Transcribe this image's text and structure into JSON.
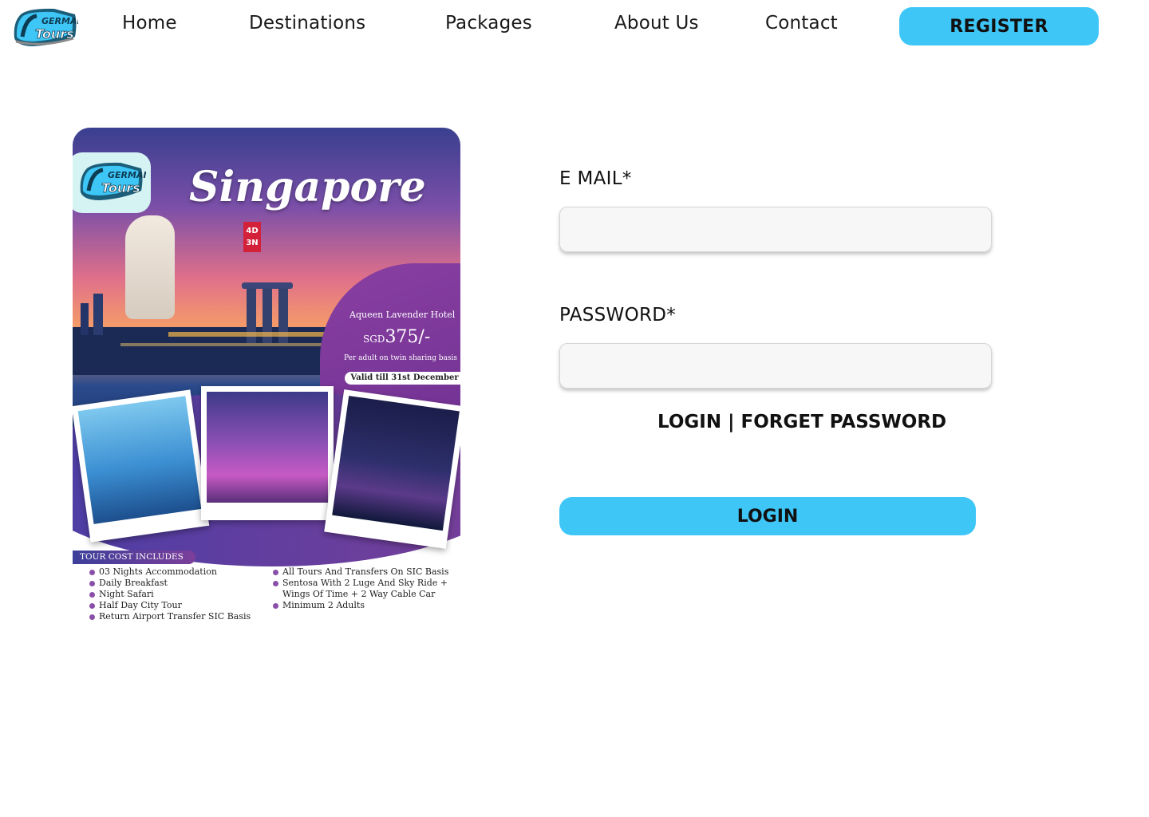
{
  "brand": {
    "logo_text_top": "GERMAN",
    "logo_text_bottom": "Tours"
  },
  "nav": {
    "items": [
      {
        "label": "Home"
      },
      {
        "label": "Destinations"
      },
      {
        "label": "Packages"
      },
      {
        "label": "About Us"
      },
      {
        "label": "Contact"
      }
    ],
    "register_label": "REGISTER"
  },
  "promo": {
    "title": "Singapore",
    "duration_days": "4D",
    "duration_nights": "3N",
    "hotel": "Aqueen Lavender Hotel",
    "currency": "SGD",
    "price": "375/-",
    "price_note": "Per adult on twin sharing basis",
    "validity": "Valid till 31st December",
    "includes_title": "TOUR COST INCLUDES",
    "includes_left": [
      "03 Nights Accommodation",
      "Daily Breakfast",
      "Night Safari",
      "Half Day City Tour",
      "Return Airport Transfer SIC Basis"
    ],
    "includes_right": [
      "All Tours And Transfers On SIC Basis",
      "Sentosa With 2 Luge And Sky Ride + Wings Of Time + 2 Way Cable Car",
      "Minimum 2 Adults"
    ]
  },
  "form": {
    "email_label": "E MAIL*",
    "email_value": "",
    "password_label": "PASSWORD*",
    "password_value": "",
    "login_link": "LOGIN",
    "separator": " | ",
    "forgot_link": "FORGET PASSWORD",
    "login_button": "LOGIN"
  },
  "colors": {
    "accent": "#3ec6f7",
    "promo_purple": "#7a3f98"
  }
}
